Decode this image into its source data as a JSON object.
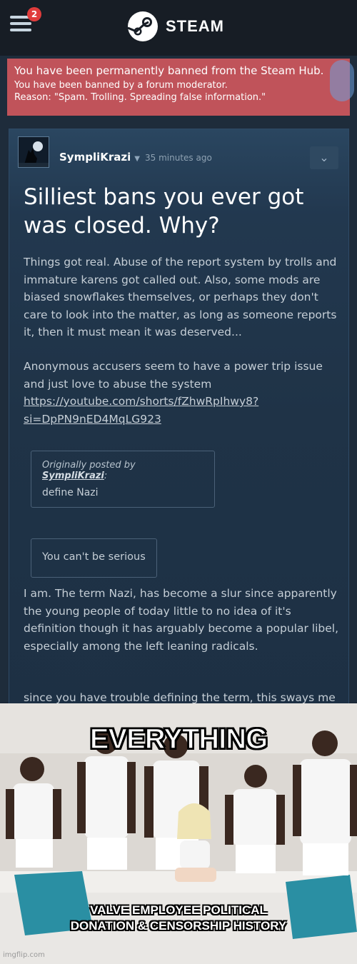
{
  "header": {
    "menu_badge": "2",
    "logo_text": "STEAM"
  },
  "ban_notice": {
    "title": "You have been permanently banned from the Steam Hub.",
    "line1": "You have been banned by a forum moderator.",
    "reason": "Reason: \"Spam. Trolling. Spreading false information.\""
  },
  "post": {
    "author": "SympliKrazi",
    "timestamp": "35 minutes ago",
    "title": "Silliest bans you ever got was closed. Why?",
    "paragraph1": "Things got real. Abuse of the report system by trolls and immature karens got called out. Also, some mods are biased snowflakes themselves, or perhaps they don't care to look into the matter, as long as someone reports it, then it must mean it was deserved...",
    "paragraph2": "Anonymous accusers seem to have a power trip issue and just love to abuse the system",
    "link_line1": "https://youtube.com/shorts/fZhwRpIhwy8?",
    "link_line2": "si=DpPN9nED4MqLG923",
    "quote1": {
      "prefix": "Originally posted by ",
      "user": "SympliKrazi",
      "suffix": ":",
      "body": "define Nazi"
    },
    "quote2": "You can't be serious",
    "paragraph3": "I am. The term Nazi, has become a slur since apparently the young people of today little to no idea of it's definition though it has arguably become a popular libel, especially among the left leaning radicals.",
    "paragraph4": "since you have trouble defining the term, this sways me to believe you used it as a slur rather than by it's"
  },
  "meme": {
    "top_caption": "EVERYTHING",
    "bottom_caption_line1": "VALVE EMPLOYEE POLITICAL",
    "bottom_caption_line2": "DONATION & CENSORSHIP HISTORY",
    "watermark": "imgflip.com"
  },
  "colors": {
    "ban_red": "#c0535a",
    "steam_dark": "#171d25",
    "post_blue": "#22384f",
    "badge_red": "#e03c3c"
  }
}
